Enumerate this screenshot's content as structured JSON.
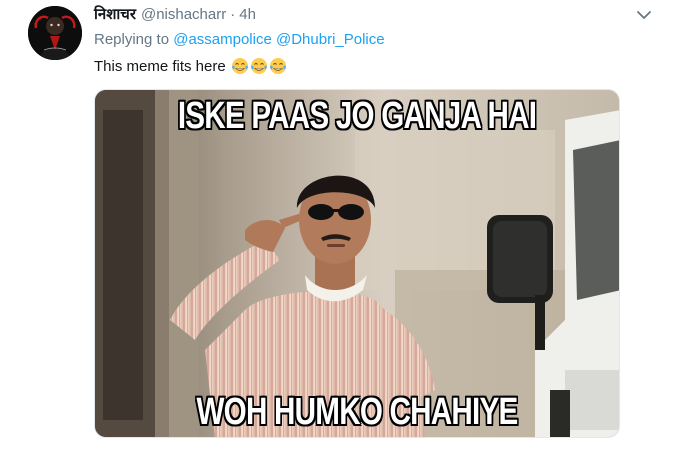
{
  "tweet": {
    "display_name": "निशाचर",
    "handle": "@nishacharr",
    "separator": "·",
    "time": "4h",
    "reply": {
      "prefix": "Replying to",
      "mentions": [
        "@assampolice",
        "@Dhubri_Police"
      ]
    },
    "text": "This meme fits here",
    "emojis": [
      "face-with-tears-of-joy",
      "face-with-tears-of-joy",
      "face-with-tears-of-joy"
    ],
    "icons": {
      "more": "chevron-down-icon",
      "avatar": "avatar-image"
    },
    "media": {
      "caption_top": "ISKE PAAS JO GANJA HAI",
      "caption_bottom": "WOH HUMKO CHAHIYE"
    }
  },
  "colors": {
    "text_primary": "#14171a",
    "text_secondary": "#657786",
    "link": "#1da1f2",
    "border": "#e1e8ed"
  }
}
